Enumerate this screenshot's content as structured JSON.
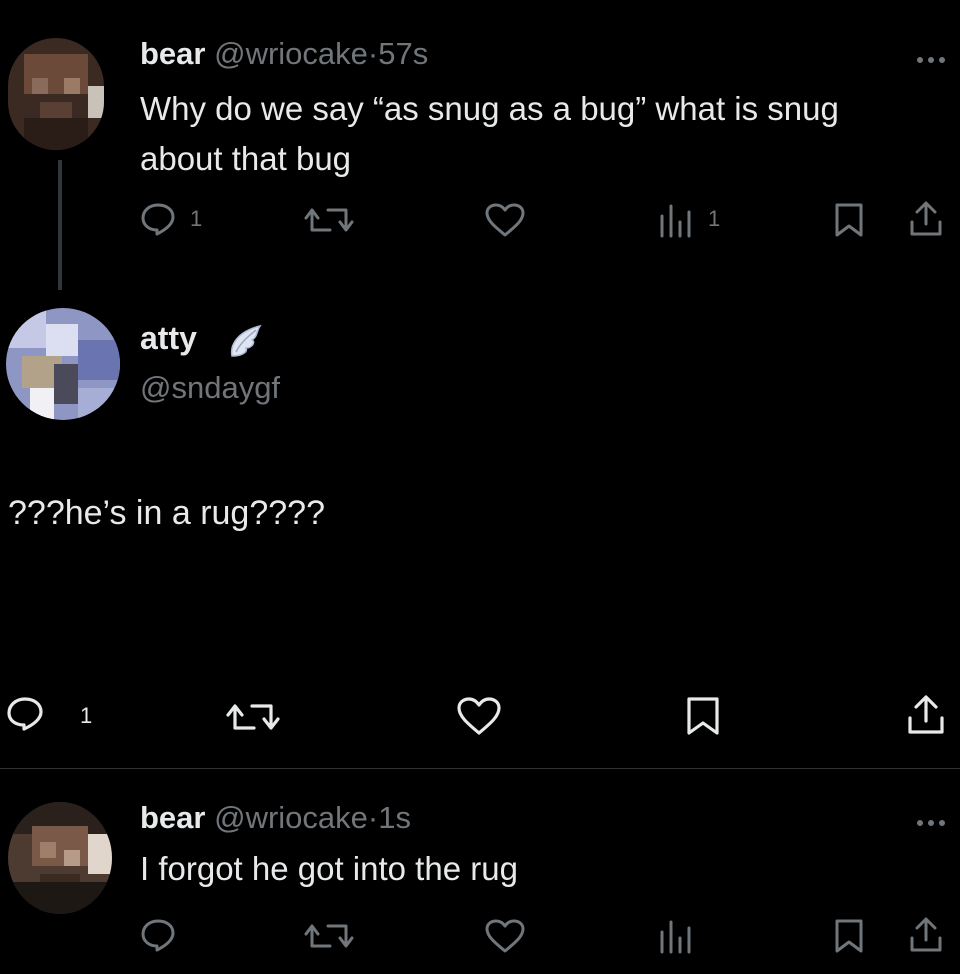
{
  "tweet1": {
    "display_name": "bear",
    "handle": "@wriocake",
    "separator": "·",
    "time": "57s",
    "text_line1": "Why do we say “as snug as a bug” what is snug",
    "text_line2": "about that bug",
    "replies": "1",
    "views": "1"
  },
  "quoted": {
    "display_name": "atty",
    "handle": "@sndaygf",
    "text": "???he’s in a rug????",
    "replies": "1"
  },
  "tweet2": {
    "display_name": "bear",
    "handle": "@wriocake",
    "separator": "·",
    "time": "1s",
    "text": "I forgot he got into the rug"
  },
  "colors": {
    "background": "#000000",
    "text": "#e7e9ea",
    "muted": "#71767b",
    "divider": "#2f3336"
  }
}
